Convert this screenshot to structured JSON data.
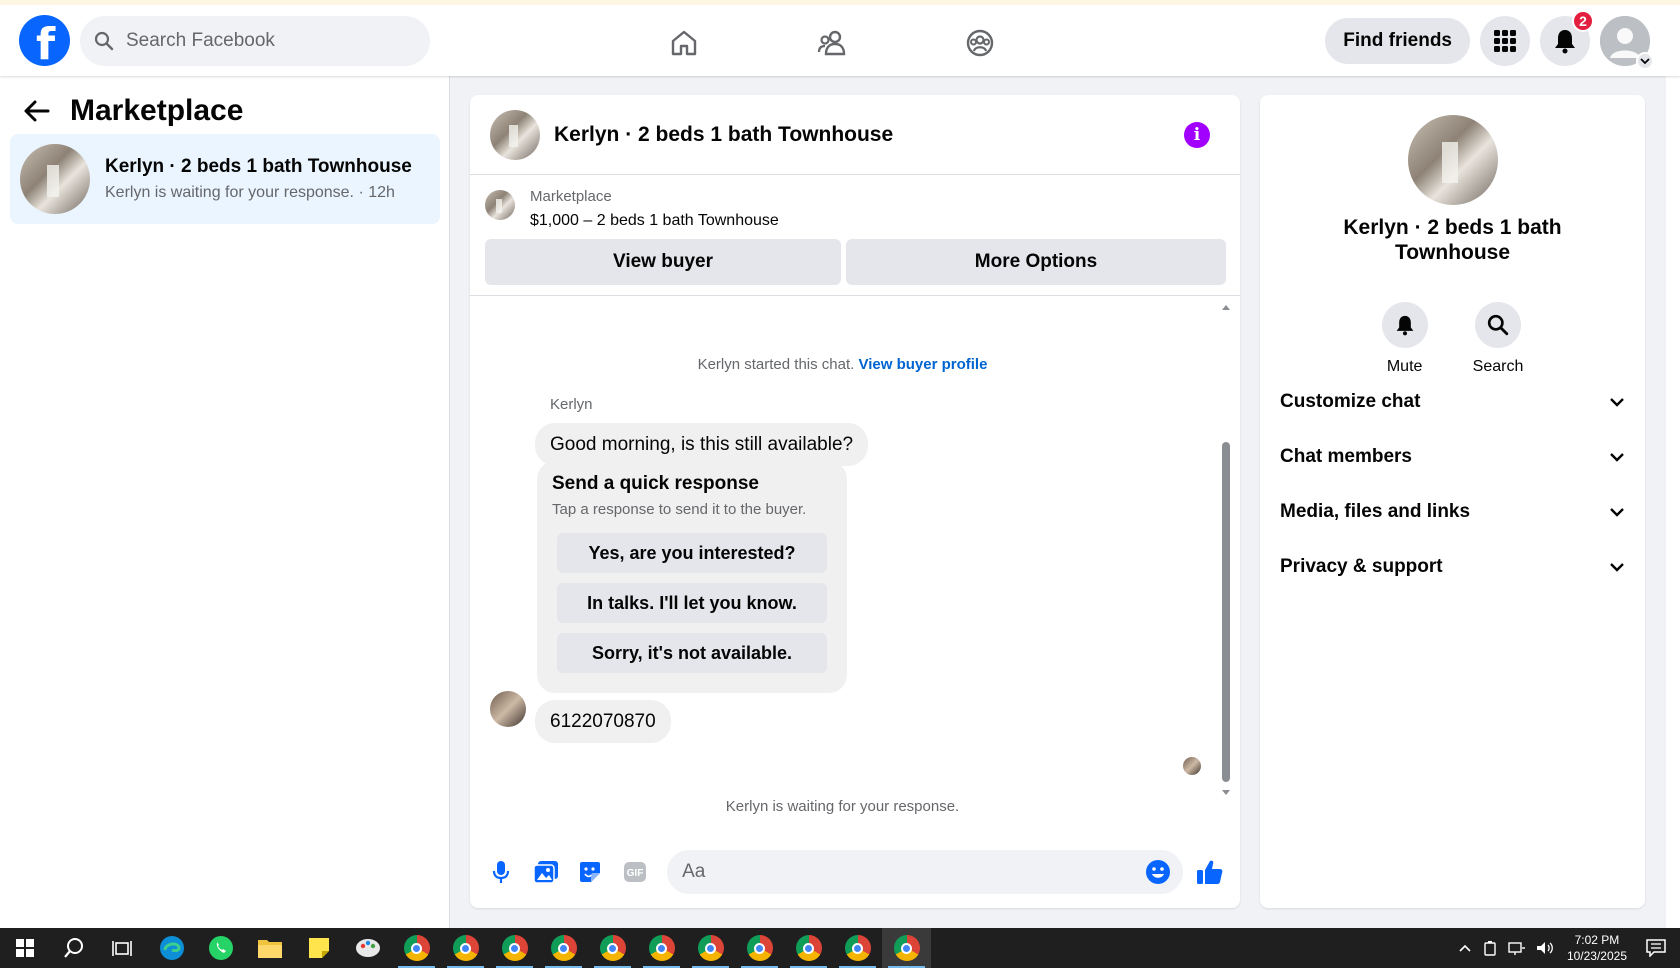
{
  "header": {
    "search_placeholder": "Search Facebook",
    "find_friends_label": "Find friends",
    "notification_count": "2",
    "brand_color": "#0866ff"
  },
  "left": {
    "title": "Marketplace",
    "conversation": {
      "title": "Kerlyn · 2 beds 1 bath Townhouse",
      "subtitle": "Kerlyn is waiting for your response. · 12h"
    }
  },
  "chat": {
    "title": "Kerlyn · 2 beds 1 bath Townhouse",
    "listing": {
      "source": "Marketplace",
      "title": "$1,000 – 2 beds 1 bath Townhouse",
      "view_buyer_label": "View buyer",
      "more_options_label": "More Options"
    },
    "started_text": "Kerlyn started this chat.",
    "view_buyer_profile_link": "View buyer profile",
    "sender_name": "Kerlyn",
    "messages": [
      "Good morning, is this still available?",
      "6122070870"
    ],
    "quick_response": {
      "title": "Send a quick response",
      "subtitle": "Tap a response to send it to the buyer.",
      "options": [
        "Yes, are you interested?",
        "In talks. I'll let you know.",
        "Sorry, it's not available."
      ]
    },
    "waiting_text": "Kerlyn is waiting for your response.",
    "composer_placeholder": "Aa",
    "accent_color": "#0866ff"
  },
  "right": {
    "title": "Kerlyn · 2 beds 1 bath Townhouse",
    "actions": [
      "Mute",
      "Search"
    ],
    "sections": [
      "Customize chat",
      "Chat members",
      "Media, files and links",
      "Privacy & support"
    ]
  },
  "taskbar": {
    "time": "7:02 PM",
    "date": "10/23/2025"
  }
}
